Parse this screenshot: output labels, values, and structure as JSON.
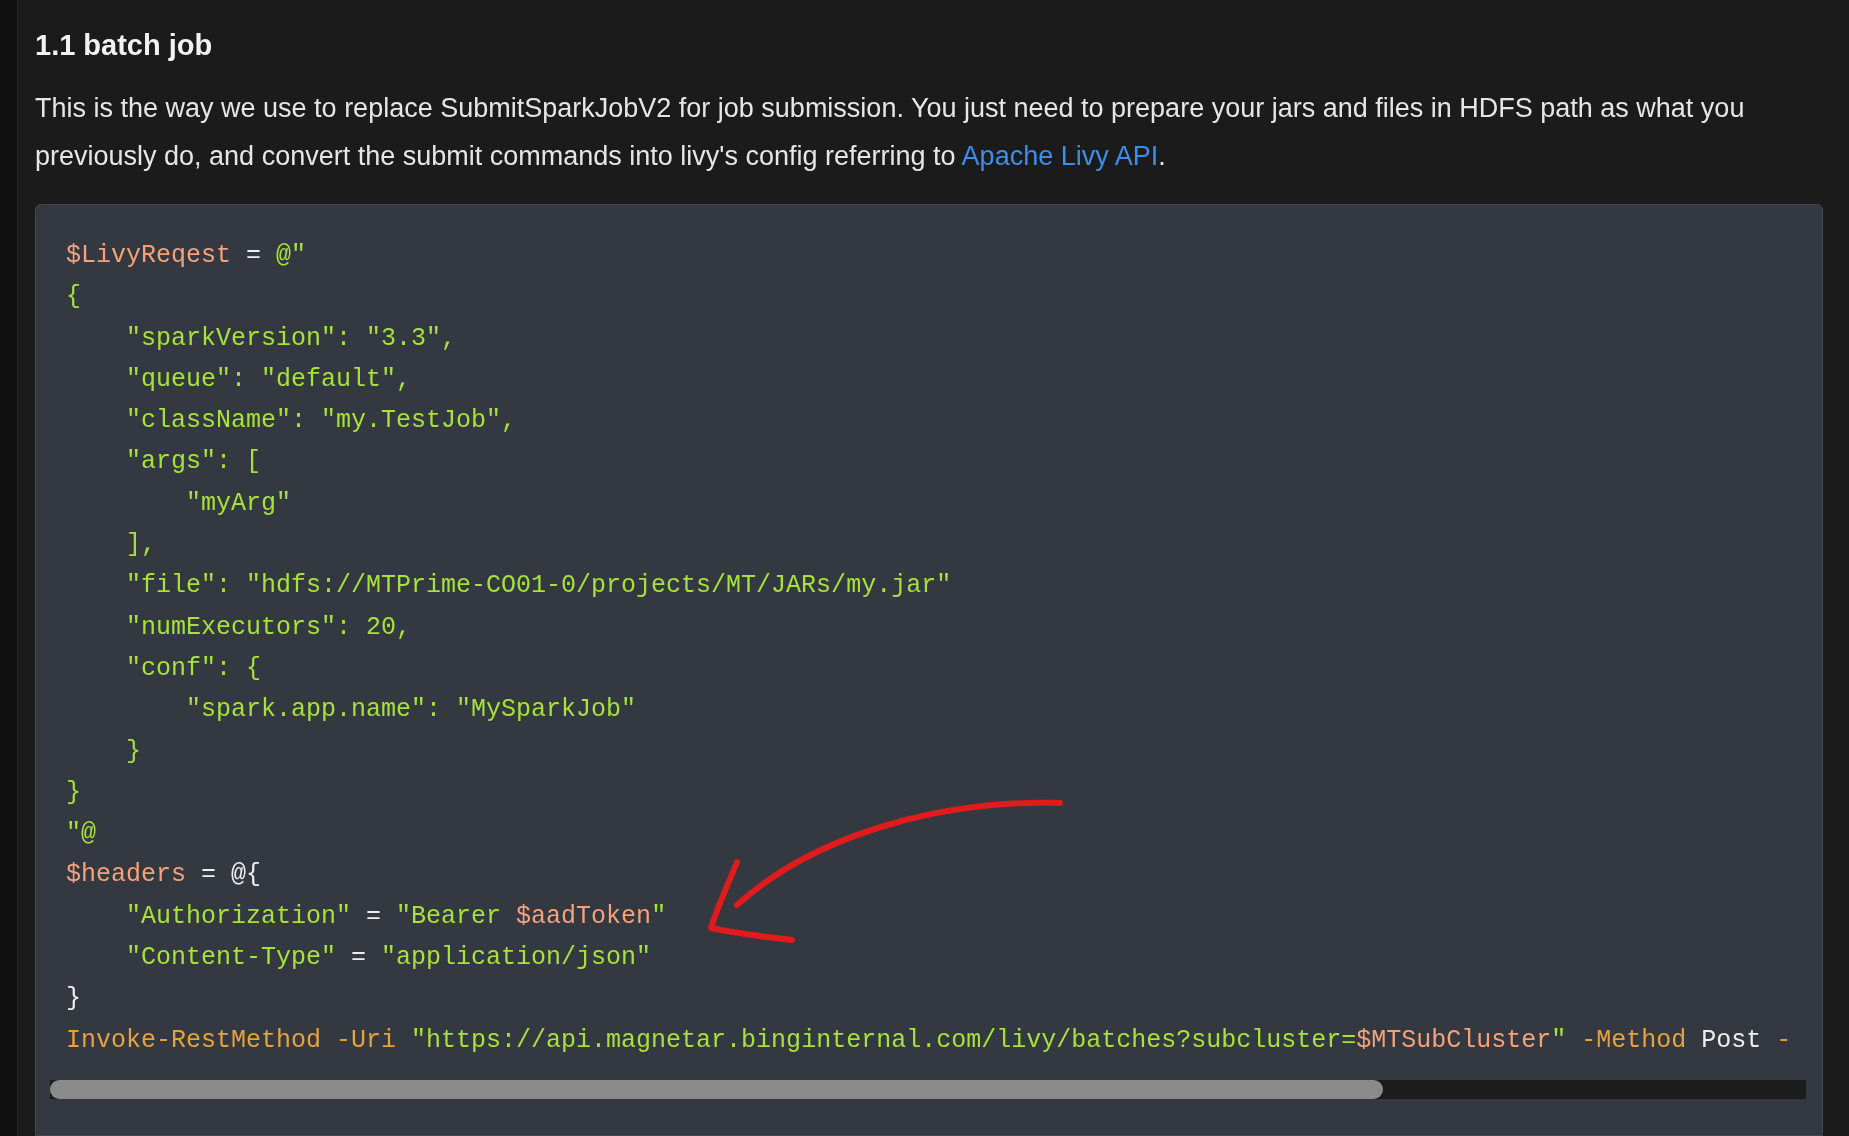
{
  "heading": "1.1 batch job",
  "paragraph": {
    "text": "This is the way we use to replace SubmitSparkJobV2 for job submission. You just need to prepare your jars and files in HDFS path as what you previously do, and convert the submit commands into livy's config referring to",
    "link": "Apache Livy API",
    "end": "."
  },
  "code_lines": [
    [
      {
        "kind": "variable",
        "text": "$LivyReqest"
      },
      {
        "kind": "plain",
        "text": " = "
      },
      {
        "kind": "string",
        "text": "@\""
      }
    ],
    [
      {
        "kind": "string",
        "text": "{"
      }
    ],
    [
      {
        "kind": "string",
        "text": "    \"sparkVersion\": \"3.3\","
      }
    ],
    [
      {
        "kind": "string",
        "text": "    \"queue\": \"default\","
      }
    ],
    [
      {
        "kind": "string",
        "text": "    \"className\": \"my.TestJob\","
      }
    ],
    [
      {
        "kind": "string",
        "text": "    \"args\": ["
      }
    ],
    [
      {
        "kind": "string",
        "text": "        \"myArg\""
      }
    ],
    [
      {
        "kind": "string",
        "text": "    ],"
      }
    ],
    [
      {
        "kind": "string",
        "text": "    \"file\": \"hdfs://MTPrime-CO01-0/projects/MT/JARs/my.jar\""
      }
    ],
    [
      {
        "kind": "string",
        "text": "    \"numExecutors\": 20,"
      }
    ],
    [
      {
        "kind": "string",
        "text": "    \"conf\": {"
      }
    ],
    [
      {
        "kind": "string",
        "text": "        \"spark.app.name\": \"MySparkJob\""
      }
    ],
    [
      {
        "kind": "string",
        "text": "    }"
      }
    ],
    [
      {
        "kind": "string",
        "text": "}"
      }
    ],
    [
      {
        "kind": "string",
        "text": "\"@"
      }
    ],
    [
      {
        "kind": "variable",
        "text": "$headers"
      },
      {
        "kind": "plain",
        "text": " = @{"
      }
    ],
    [
      {
        "kind": "string",
        "text": "    \"Authorization\""
      },
      {
        "kind": "plain",
        "text": " = "
      },
      {
        "kind": "string",
        "text": "\"Bearer "
      },
      {
        "kind": "variable",
        "text": "$aadToken"
      },
      {
        "kind": "string",
        "text": "\""
      }
    ],
    [
      {
        "kind": "string",
        "text": "    \"Content-Type\""
      },
      {
        "kind": "plain",
        "text": " = "
      },
      {
        "kind": "string",
        "text": "\"application/json\""
      }
    ],
    [
      {
        "kind": "plain",
        "text": "}"
      }
    ],
    [
      {
        "kind": "command",
        "text": "Invoke-RestMethod -Uri "
      },
      {
        "kind": "string",
        "text": "\"https://api.magnetar.binginternal.com/livy/batches?subcluster="
      },
      {
        "kind": "variable",
        "text": "$MTSubCluster"
      },
      {
        "kind": "string",
        "text": "\""
      },
      {
        "kind": "command",
        "text": " -Method "
      },
      {
        "kind": "plain",
        "text": "Post"
      },
      {
        "kind": "command",
        "text": " -"
      }
    ]
  ]
}
